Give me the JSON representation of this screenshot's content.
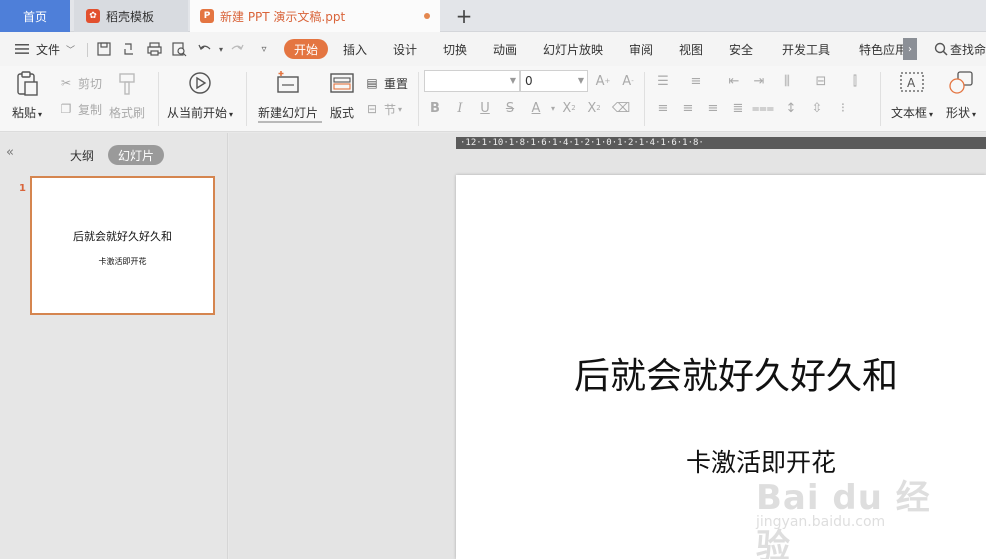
{
  "tabs": {
    "home": "首页",
    "template": "稻壳模板",
    "document": "新建 PPT 演示文稿.ppt",
    "add": "+"
  },
  "menu": {
    "file": "文件",
    "items": [
      "开始",
      "插入",
      "设计",
      "切换",
      "动画",
      "幻灯片放映",
      "审阅",
      "视图",
      "安全",
      "开发工具",
      "特色应用"
    ],
    "search": "查找命"
  },
  "ribbon": {
    "paste": "粘贴",
    "cut": "剪切",
    "copy": "复制",
    "format_painter": "格式刷",
    "play_from_current": "从当前开始",
    "new_slide": "新建幻灯片",
    "layout": "版式",
    "reset": "重置",
    "section": "节",
    "font_name": "",
    "font_size": "0",
    "text_box": "文本框",
    "shape": "形状"
  },
  "left_panel": {
    "outline_tab": "大纲",
    "slides_tab": "幻灯片",
    "slide_number": "1",
    "thumb_title": "后就会就好久好久和",
    "thumb_subtitle": "卡激活即开花"
  },
  "ruler": {
    "text": "·12·1·10·1·8·1·6·1·4·1·2·1·0·1·2·1·4·1·6·1·8·"
  },
  "slide": {
    "title": "后就会就好久好久和",
    "subtitle": "卡激活即开花"
  },
  "watermark": {
    "line1": "Bai du 经验",
    "line2": "jingyan.baidu.com"
  },
  "colors": {
    "accent": "#e47541",
    "home_tab": "#4e7fd9",
    "selection_border": "#d5854f"
  }
}
